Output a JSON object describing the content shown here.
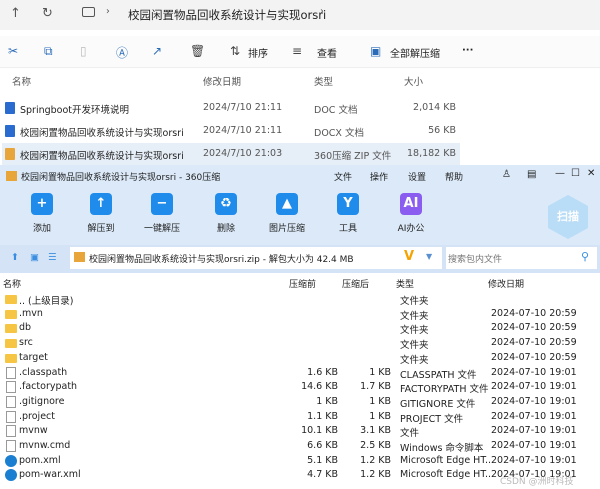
{
  "explorer": {
    "breadcrumb": "校园闲置物品回收系统设计与实现orsri",
    "toolbar": {
      "sort": "排序",
      "view": "查看",
      "extract_all": "全部解压缩",
      "more": "···"
    },
    "columns": [
      "名称",
      "修改日期",
      "类型",
      "大小"
    ],
    "rows": [
      {
        "name": "Springboot开发环境说明",
        "date": "2024/7/10 21:11",
        "type": "DOC 文档",
        "size": "2,014 KB",
        "icon": "doc"
      },
      {
        "name": "校园闲置物品回收系统设计与实现orsri",
        "date": "2024/7/10 21:11",
        "type": "DOCX 文档",
        "size": "56 KB",
        "icon": "docx"
      },
      {
        "name": "校园闲置物品回收系统设计与实现orsri",
        "date": "2024/7/10 21:03",
        "type": "360压缩 ZIP 文件",
        "size": "18,182 KB",
        "icon": "zip"
      }
    ]
  },
  "zip": {
    "title": "校园闲置物品回收系统设计与实现orsri - 360压缩",
    "menu": [
      "文件",
      "操作",
      "设置",
      "帮助"
    ],
    "tools": [
      {
        "label": "添加",
        "glyph": "+",
        "color": "#1f8ceb"
      },
      {
        "label": "解压到",
        "glyph": "↑",
        "color": "#1f8ceb"
      },
      {
        "label": "一键解压",
        "glyph": "−",
        "color": "#1f8ceb"
      },
      {
        "label": "删除",
        "glyph": "♻",
        "color": "#1f8ceb"
      },
      {
        "label": "图片压缩",
        "glyph": "▲",
        "color": "#1f8ceb"
      },
      {
        "label": "工具",
        "glyph": "Y",
        "color": "#1f8ceb"
      },
      {
        "label": "AI办公",
        "glyph": "AI",
        "color": "#8a5cf0"
      }
    ],
    "scan": "扫描",
    "path": "校园闲置物品回收系统设计与实现orsri.zip - 解包大小为 42.4 MB",
    "search_placeholder": "搜索包内文件",
    "columns": [
      "名称",
      "压缩前",
      "压缩后",
      "类型",
      "修改日期"
    ],
    "rows": [
      {
        "name": ".. (上级目录)",
        "before": "",
        "after": "",
        "type": "文件夹",
        "date": "",
        "icon": "folder"
      },
      {
        "name": ".mvn",
        "before": "",
        "after": "",
        "type": "文件夹",
        "date": "2024-07-10 20:59",
        "icon": "folder"
      },
      {
        "name": "db",
        "before": "",
        "after": "",
        "type": "文件夹",
        "date": "2024-07-10 20:59",
        "icon": "folder"
      },
      {
        "name": "src",
        "before": "",
        "after": "",
        "type": "文件夹",
        "date": "2024-07-10 20:59",
        "icon": "folder"
      },
      {
        "name": "target",
        "before": "",
        "after": "",
        "type": "文件夹",
        "date": "2024-07-10 20:59",
        "icon": "folder"
      },
      {
        "name": ".classpath",
        "before": "1.6 KB",
        "after": "1 KB",
        "type": "CLASSPATH 文件",
        "date": "2024-07-10 19:01",
        "icon": "file"
      },
      {
        "name": ".factorypath",
        "before": "14.6 KB",
        "after": "1.7 KB",
        "type": "FACTORYPATH 文件",
        "date": "2024-07-10 19:01",
        "icon": "file"
      },
      {
        "name": ".gitignore",
        "before": "1 KB",
        "after": "1 KB",
        "type": "GITIGNORE 文件",
        "date": "2024-07-10 19:01",
        "icon": "file"
      },
      {
        "name": ".project",
        "before": "1.1 KB",
        "after": "1 KB",
        "type": "PROJECT 文件",
        "date": "2024-07-10 19:01",
        "icon": "file"
      },
      {
        "name": "mvnw",
        "before": "10.1 KB",
        "after": "3.1 KB",
        "type": "文件",
        "date": "2024-07-10 19:01",
        "icon": "file"
      },
      {
        "name": "mvnw.cmd",
        "before": "6.6 KB",
        "after": "2.5 KB",
        "type": "Windows 命令脚本",
        "date": "2024-07-10 19:01",
        "icon": "file"
      },
      {
        "name": "pom.xml",
        "before": "5.1 KB",
        "after": "1.2 KB",
        "type": "Microsoft Edge HT...",
        "date": "2024-07-10 19:01",
        "icon": "edge"
      },
      {
        "name": "pom-war.xml",
        "before": "4.7 KB",
        "after": "1.2 KB",
        "type": "Microsoft Edge HT...",
        "date": "2024-07-10 19:01",
        "icon": "edge"
      }
    ]
  },
  "watermark": "CSDN @洲时科技"
}
